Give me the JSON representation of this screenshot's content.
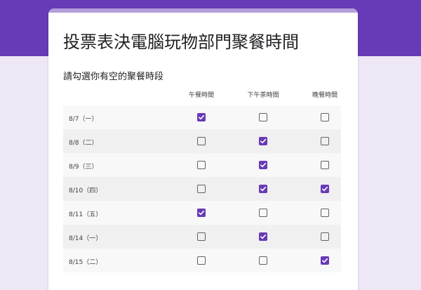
{
  "form": {
    "title": "投票表決電腦玩物部門聚餐時間",
    "question": "請勾選你有空的聚餐時段",
    "columns": [
      "午餐時間",
      "下午茶時間",
      "晚餐時間"
    ],
    "rows": [
      {
        "label": "8/7（一）",
        "checked": [
          true,
          false,
          false
        ]
      },
      {
        "label": "8/8（二）",
        "checked": [
          false,
          true,
          false
        ]
      },
      {
        "label": "8/9（三）",
        "checked": [
          false,
          true,
          false
        ]
      },
      {
        "label": "8/10（四）",
        "checked": [
          false,
          true,
          true
        ]
      },
      {
        "label": "8/11（五）",
        "checked": [
          true,
          false,
          false
        ]
      },
      {
        "label": "8/14（一）",
        "checked": [
          false,
          true,
          false
        ]
      },
      {
        "label": "8/15（二）",
        "checked": [
          false,
          false,
          true
        ]
      }
    ]
  },
  "colors": {
    "accent": "#673ab7",
    "background": "#ede7f6",
    "card_accent": "#b39ddb"
  },
  "icons": {
    "check": "check-icon"
  }
}
